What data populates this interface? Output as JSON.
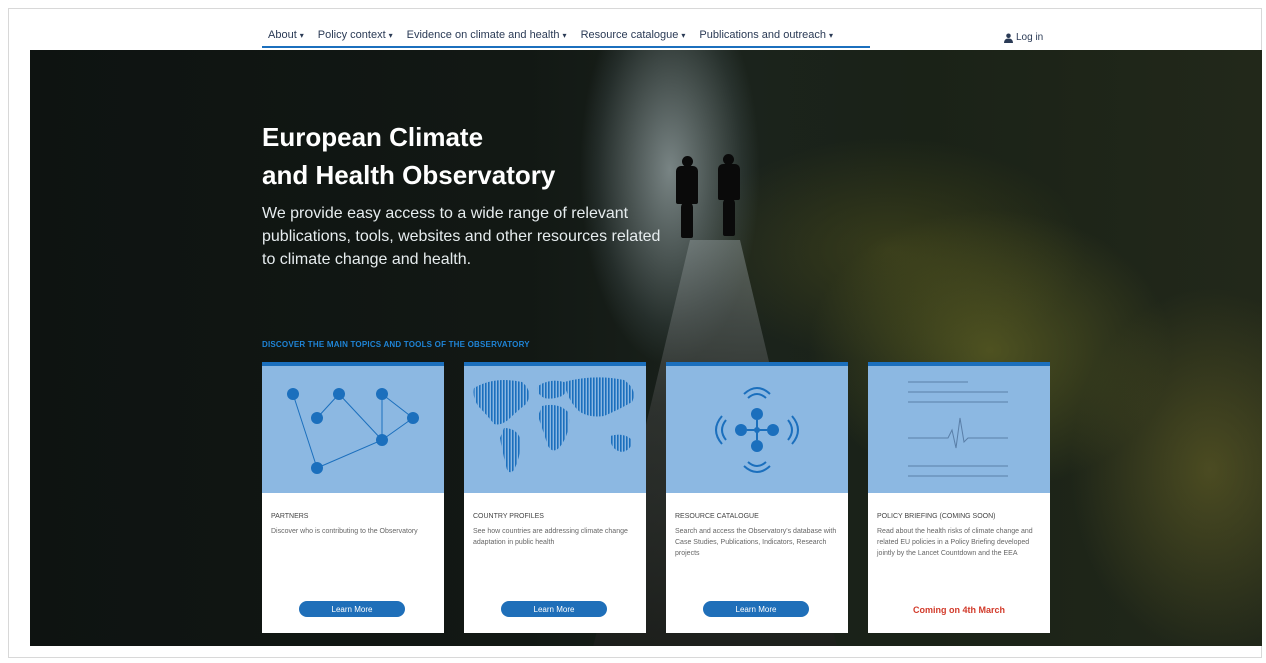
{
  "nav": {
    "items": [
      {
        "label": "About"
      },
      {
        "label": "Policy context"
      },
      {
        "label": "Evidence on climate and health"
      },
      {
        "label": "Resource catalogue"
      },
      {
        "label": "Publications and outreach"
      }
    ],
    "login_label": "Log in"
  },
  "hero": {
    "title_line1": "European Climate",
    "title_line2": "and Health Observatory",
    "subtitle": "We provide easy access to a wide range of relevant publications, tools, websites and other resources related to climate change and health.",
    "discover_label": "DISCOVER THE MAIN TOPICS AND TOOLS OF THE OBSERVATORY"
  },
  "cards": [
    {
      "icon": "network-icon",
      "title": "PARTNERS",
      "description": "Discover who is contributing to the Observatory",
      "button": "Learn More"
    },
    {
      "icon": "world-map-icon",
      "title": "COUNTRY PROFILES",
      "description": "See how countries are addressing climate change adaptation in public health",
      "button": "Learn More"
    },
    {
      "icon": "catalogue-icon",
      "title": "RESOURCE CATALOGUE",
      "description": "Search and access the Observatory's database with Case Studies, Publications, Indicators, Research projects",
      "button": "Learn More"
    },
    {
      "icon": "pulse-icon",
      "title": "POLICY BRIEFING (COMING SOON)",
      "description": "Read about the health risks of climate change and related EU policies in a Policy Briefing developed jointly by the Lancet Countdown and the EEA",
      "status": "Coming on 4th March"
    }
  ],
  "colors": {
    "accent": "#1b6fbd",
    "card_image_bg": "#8cb8e2",
    "coming_soon": "#d23a2a"
  }
}
